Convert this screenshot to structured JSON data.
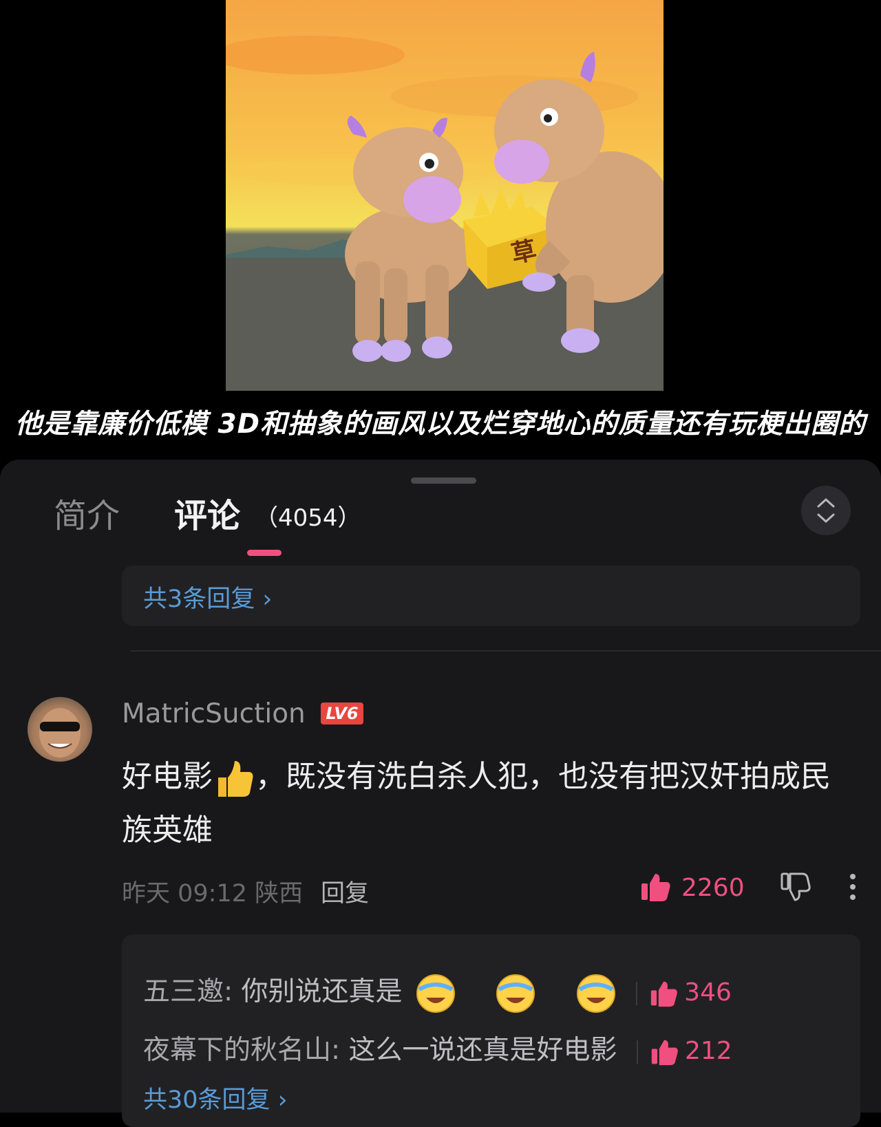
{
  "video": {
    "subtitle": "他是靠廉价低模 3D和抽象的画风以及烂穿地心的质量还有玩梗出圈的",
    "box_label": "草"
  },
  "tabs": {
    "intro_label": "简介",
    "comments_label": "评论",
    "comments_count": "（4054）"
  },
  "prev_replies_link": "共3条回复 ›",
  "comment": {
    "username": "MatricSuction",
    "level": "LV6",
    "text_part1": "好电影",
    "text_part2": "，既没有洗白杀人犯，也没有把汉奸拍成民族英雄",
    "meta": "昨天 09:12 陕西",
    "reply_label": "回复",
    "likes": "2260"
  },
  "sub_replies": [
    {
      "name": "五三邀:",
      "text": " 你别说还真是",
      "likes": "346"
    },
    {
      "name": "夜幕下的秋名山:",
      "text": " 这么一说还真是好电影",
      "likes": "212"
    }
  ],
  "more_replies_link": "共30条回复 ›",
  "colors": {
    "accent_pink": "#f0507f",
    "link_blue": "#5a9bd6",
    "sheet_bg": "#18181a"
  },
  "icons": [
    "chevron-up-down-icon",
    "thumbs-up-icon",
    "thumbs-down-icon",
    "more-vertical-icon",
    "laughing-crying-icon",
    "thumbs-up-emoji"
  ]
}
